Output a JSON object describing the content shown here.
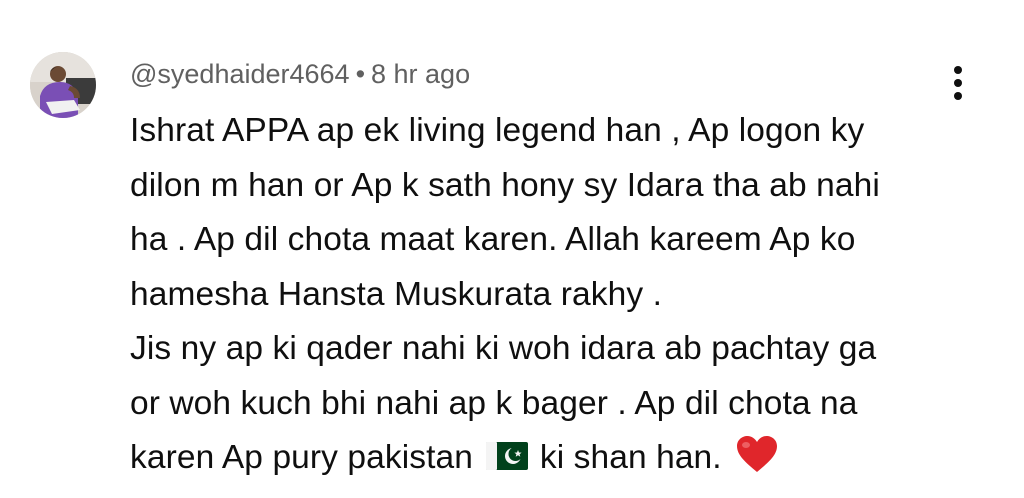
{
  "comment": {
    "author": "@syedhaider4664",
    "separator": "•",
    "time": "8 hr ago",
    "lines": [
      "Ishrat APPA ap ek living legend han , Ap logon ky",
      "dilon m han or Ap k sath hony sy Idara tha ab nahi",
      "ha . Ap dil chota maat karen. Allah kareem Ap ko",
      "hamesha Hansta Muskurata rakhy .",
      "Jis ny ap ki qader nahi ki woh idara ab pachtay ga",
      "or woh kuch bhi nahi ap k bager . Ap dil chota na",
      "karen Ap pury pakistan"
    ],
    "last_line_tail": "ki shan han.",
    "flag_icon": "pakistan-flag-emoji",
    "heart_icon": "red-heart-emoji",
    "menu_icon": "more-vertical-icon"
  },
  "colors": {
    "meta": "#606060",
    "text": "#0f0f0f",
    "heart": "#e0262b",
    "flag_green": "#01411c"
  }
}
